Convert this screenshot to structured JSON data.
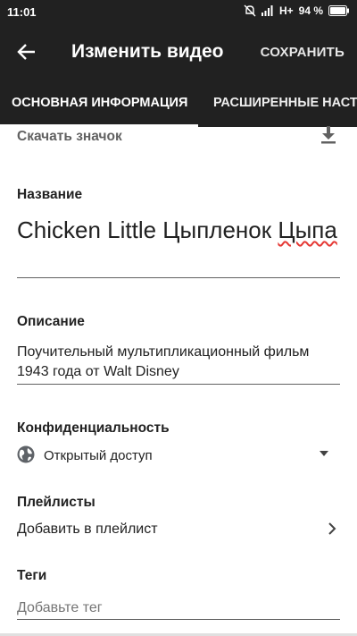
{
  "status_bar": {
    "time": "11:01",
    "network": "H+",
    "battery": "94 %",
    "icons": [
      "mute-icon",
      "signal-icon",
      "battery-icon"
    ]
  },
  "toolbar": {
    "back_icon": "arrow-left-icon",
    "title": "Изменить видео",
    "save_label": "СОХРАНИТЬ"
  },
  "tabs": [
    {
      "label": "ОСНОВНАЯ ИНФОРМАЦИЯ",
      "selected": true
    },
    {
      "label": "РАСШИРЕННЫЕ НАСТРОЙКИ",
      "selected": false
    }
  ],
  "thumbnail": {
    "label": "Скачать значок",
    "icon": "download-icon"
  },
  "fields": {
    "title": {
      "label": "Название",
      "value_start": "Chicken Little Цыпленок",
      "value_end": "Цыпа"
    },
    "description": {
      "label": "Описание",
      "value": "Поучительный мультипликационный фильм 1943 года от Walt Disney"
    },
    "privacy": {
      "label": "Конфиденциальность",
      "value": "Открытый доступ",
      "icon": "globe-icon"
    },
    "playlists": {
      "label": "Плейлисты",
      "value": "Добавить в плейлист",
      "icon": "chevron-right-icon"
    },
    "tags": {
      "label": "Теги",
      "placeholder": "Добавьте тег"
    }
  },
  "colors": {
    "app_bar": "#212121",
    "text_primary": "#212121",
    "text_secondary": "#616161",
    "spellcheck": "#e53935"
  }
}
